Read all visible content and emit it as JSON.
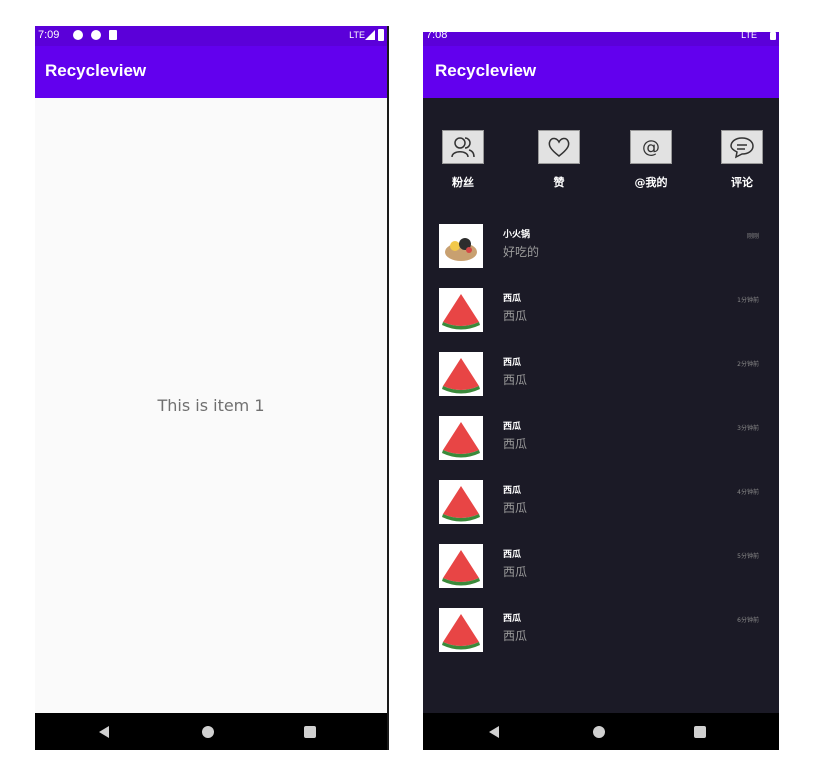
{
  "left_phone": {
    "status": {
      "time": "7:09",
      "network": "LTE"
    },
    "app_title": "Recycleview",
    "center_text": "This is item 1"
  },
  "right_phone": {
    "status": {
      "time": "7:08",
      "network": "LTE"
    },
    "app_title": "Recycleview",
    "categories": [
      {
        "label": "粉丝",
        "icon": "fans-icon"
      },
      {
        "label": "赞",
        "icon": "heart-icon"
      },
      {
        "label": "@我的",
        "icon": "at-icon"
      },
      {
        "label": "评论",
        "icon": "comment-icon"
      }
    ],
    "messages": [
      {
        "name": "小火锅",
        "text": "好吃的",
        "time": "刚刚",
        "avatar": "hotpot-thumbnail"
      },
      {
        "name": "西瓜",
        "text": "西瓜",
        "time": "1分钟前",
        "avatar": "watermelon-thumbnail"
      },
      {
        "name": "西瓜",
        "text": "西瓜",
        "time": "2分钟前",
        "avatar": "watermelon-thumbnail"
      },
      {
        "name": "西瓜",
        "text": "西瓜",
        "time": "3分钟前",
        "avatar": "watermelon-thumbnail"
      },
      {
        "name": "西瓜",
        "text": "西瓜",
        "time": "4分钟前",
        "avatar": "watermelon-thumbnail"
      },
      {
        "name": "西瓜",
        "text": "西瓜",
        "time": "5分钟前",
        "avatar": "watermelon-thumbnail"
      },
      {
        "name": "西瓜",
        "text": "西瓜",
        "time": "6分钟前",
        "avatar": "watermelon-thumbnail"
      }
    ]
  },
  "colors": {
    "status_bar": "#5b00d9",
    "app_bar": "#6200ee",
    "dark_bg": "#1b1a26"
  }
}
